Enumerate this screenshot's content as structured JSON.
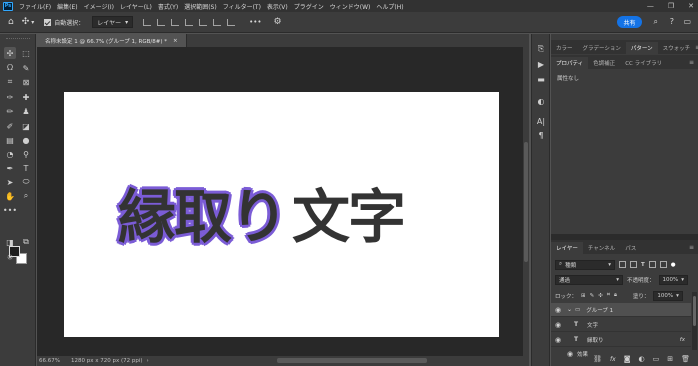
{
  "menubar": {
    "logo": "Ps",
    "items": [
      "ファイル(F)",
      "編集(E)",
      "イメージ(I)",
      "レイヤー(L)",
      "書式(Y)",
      "選択範囲(S)",
      "フィルター(T)",
      "表示(V)",
      "プラグイン",
      "ウィンドウ(W)",
      "ヘルプ(H)"
    ],
    "window_controls": [
      "—",
      "❐",
      "✕"
    ]
  },
  "options": {
    "auto_select_label": "自動選択：",
    "auto_select_value": "レイヤー",
    "more": "•••",
    "share_label": "共有"
  },
  "document": {
    "tab_title": "名称未設定 1 @ 66.7% (グループ 1, RGB/8#) *",
    "tab_close": "×",
    "art_text_outlined": "縁取り",
    "art_text_plain": "文字",
    "zoom": "66.67%",
    "doc_size": "1280 px x 720 px (72 ppi)"
  },
  "panels": {
    "top_tabs": [
      "カラー",
      "グラデーション",
      "パターン",
      "スウォッチ"
    ],
    "top_active": "パターン",
    "second_tabs": [
      "プロパティ",
      "色調補正",
      "CC ライブラリ"
    ],
    "second_active": "プロパティ",
    "attributes_label": "属性なし",
    "layers_tabs": [
      "レイヤー",
      "チャンネル",
      "パス"
    ],
    "layers_active": "レイヤー",
    "kind_label": "種類",
    "blend_mode": "通過",
    "opacity_label": "不透明度：",
    "opacity_value": "100%",
    "lock_label": "ロック：",
    "fill_label": "塗り：",
    "fill_value": "100%",
    "layers": [
      {
        "name": "グループ 1",
        "type": "group",
        "selected": true,
        "fx": ""
      },
      {
        "name": "文字",
        "type": "text",
        "selected": false,
        "fx": ""
      },
      {
        "name": "縁取り",
        "type": "text",
        "selected": false,
        "fx": "fx"
      },
      {
        "name": "効果",
        "type": "effect",
        "selected": false,
        "fx": ""
      }
    ]
  },
  "colors": {
    "accent": "#1473e6",
    "outline_purple": "#7b5cd6",
    "text_dark": "#333333"
  }
}
